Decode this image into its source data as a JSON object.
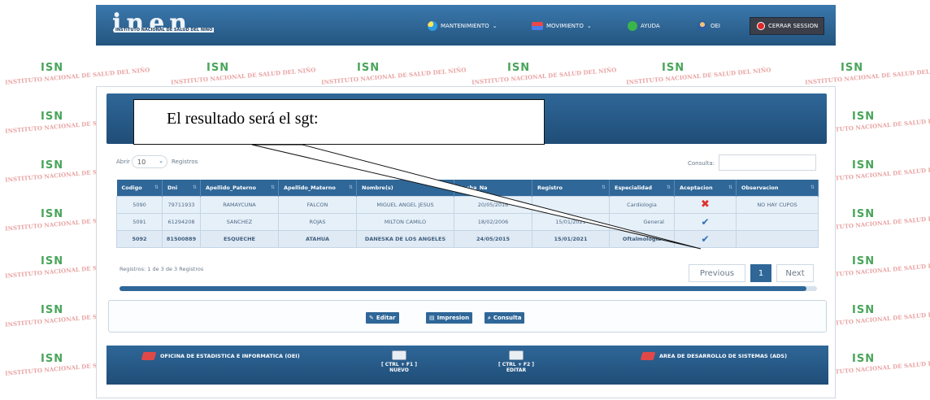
{
  "header": {
    "logo_text": "inen",
    "logo_tagline": "INSTITUTO NACIONAL DE SALUD DEL NIÑO",
    "nav": [
      {
        "label": "MANTENIMIENTO",
        "icon": "gear-flower-icon"
      },
      {
        "label": "MOVIMIENTO",
        "icon": "flag-icon"
      },
      {
        "label": "AYUDA",
        "icon": "help-icon"
      },
      {
        "label": "OEI",
        "icon": "user-icon"
      }
    ],
    "logout_label": "CERRAR SESSION"
  },
  "watermark": {
    "text": "INSTITUTO NACIONAL DE SALUD DEL NIÑO",
    "logo": "ISN"
  },
  "callout": {
    "text": "El resultado será el sgt:"
  },
  "table_controls": {
    "length_prefix": "Abrir",
    "length_value": "10",
    "length_suffix": "Registros",
    "search_label": "Consulta:"
  },
  "table": {
    "columns": [
      "Codigo",
      "Dni",
      "Apellido_Paterno",
      "Apellido_Materno",
      "Nombre(s)",
      "Fecha_Na",
      "Registro",
      "Especialidad",
      "Aceptacion",
      "Observacion"
    ],
    "rows": [
      {
        "codigo": "5090",
        "dni": "79711933",
        "ap_paterno": "RAMAYCUNA",
        "ap_materno": "FALCON",
        "nombres": "MIGUEL ANGEL JESUS",
        "fecha_nac": "20/05/2016",
        "registro": "",
        "especialidad": "Cardiologia",
        "aceptacion": "rejected",
        "observacion": "NO HAY CUPOS"
      },
      {
        "codigo": "5091",
        "dni": "61294208",
        "ap_paterno": "SANCHEZ",
        "ap_materno": "ROJAS",
        "nombres": "MILTON CAMILO",
        "fecha_nac": "18/02/2006",
        "registro": "15/01/2021",
        "especialidad": "General",
        "aceptacion": "accepted",
        "observacion": ""
      },
      {
        "codigo": "5092",
        "dni": "81500889",
        "ap_paterno": "ESQUECHE",
        "ap_materno": "ATAHUA",
        "nombres": "DANESKA DE LOS ANGELES",
        "fecha_nac": "24/05/2015",
        "registro": "15/01/2021",
        "especialidad": "Oftalmologia",
        "aceptacion": "accepted",
        "observacion": ""
      }
    ]
  },
  "info": {
    "text": "Registros: 1 de 3 de 3 Registros"
  },
  "pagination": {
    "previous": "Previous",
    "current": "1",
    "next": "Next"
  },
  "actions": {
    "edit": "Editar",
    "print": "Impresion",
    "query": "Consulta"
  },
  "footer": {
    "left_label": "OFICINA DE ESTADISTICA E INFORMATICA (OEI)",
    "key1_combo": "[ CTRL + F1 ]",
    "key1_label": "NUEVO",
    "key2_combo": "[ CTRL + F2 ]",
    "key2_label": "EDITAR",
    "right_label": "AREA DE DESARROLLO DE SISTEMAS (ADS)"
  },
  "colors": {
    "primary": "#2f6798",
    "accent_red": "#e0322e",
    "check_blue": "#2d6fb7"
  }
}
